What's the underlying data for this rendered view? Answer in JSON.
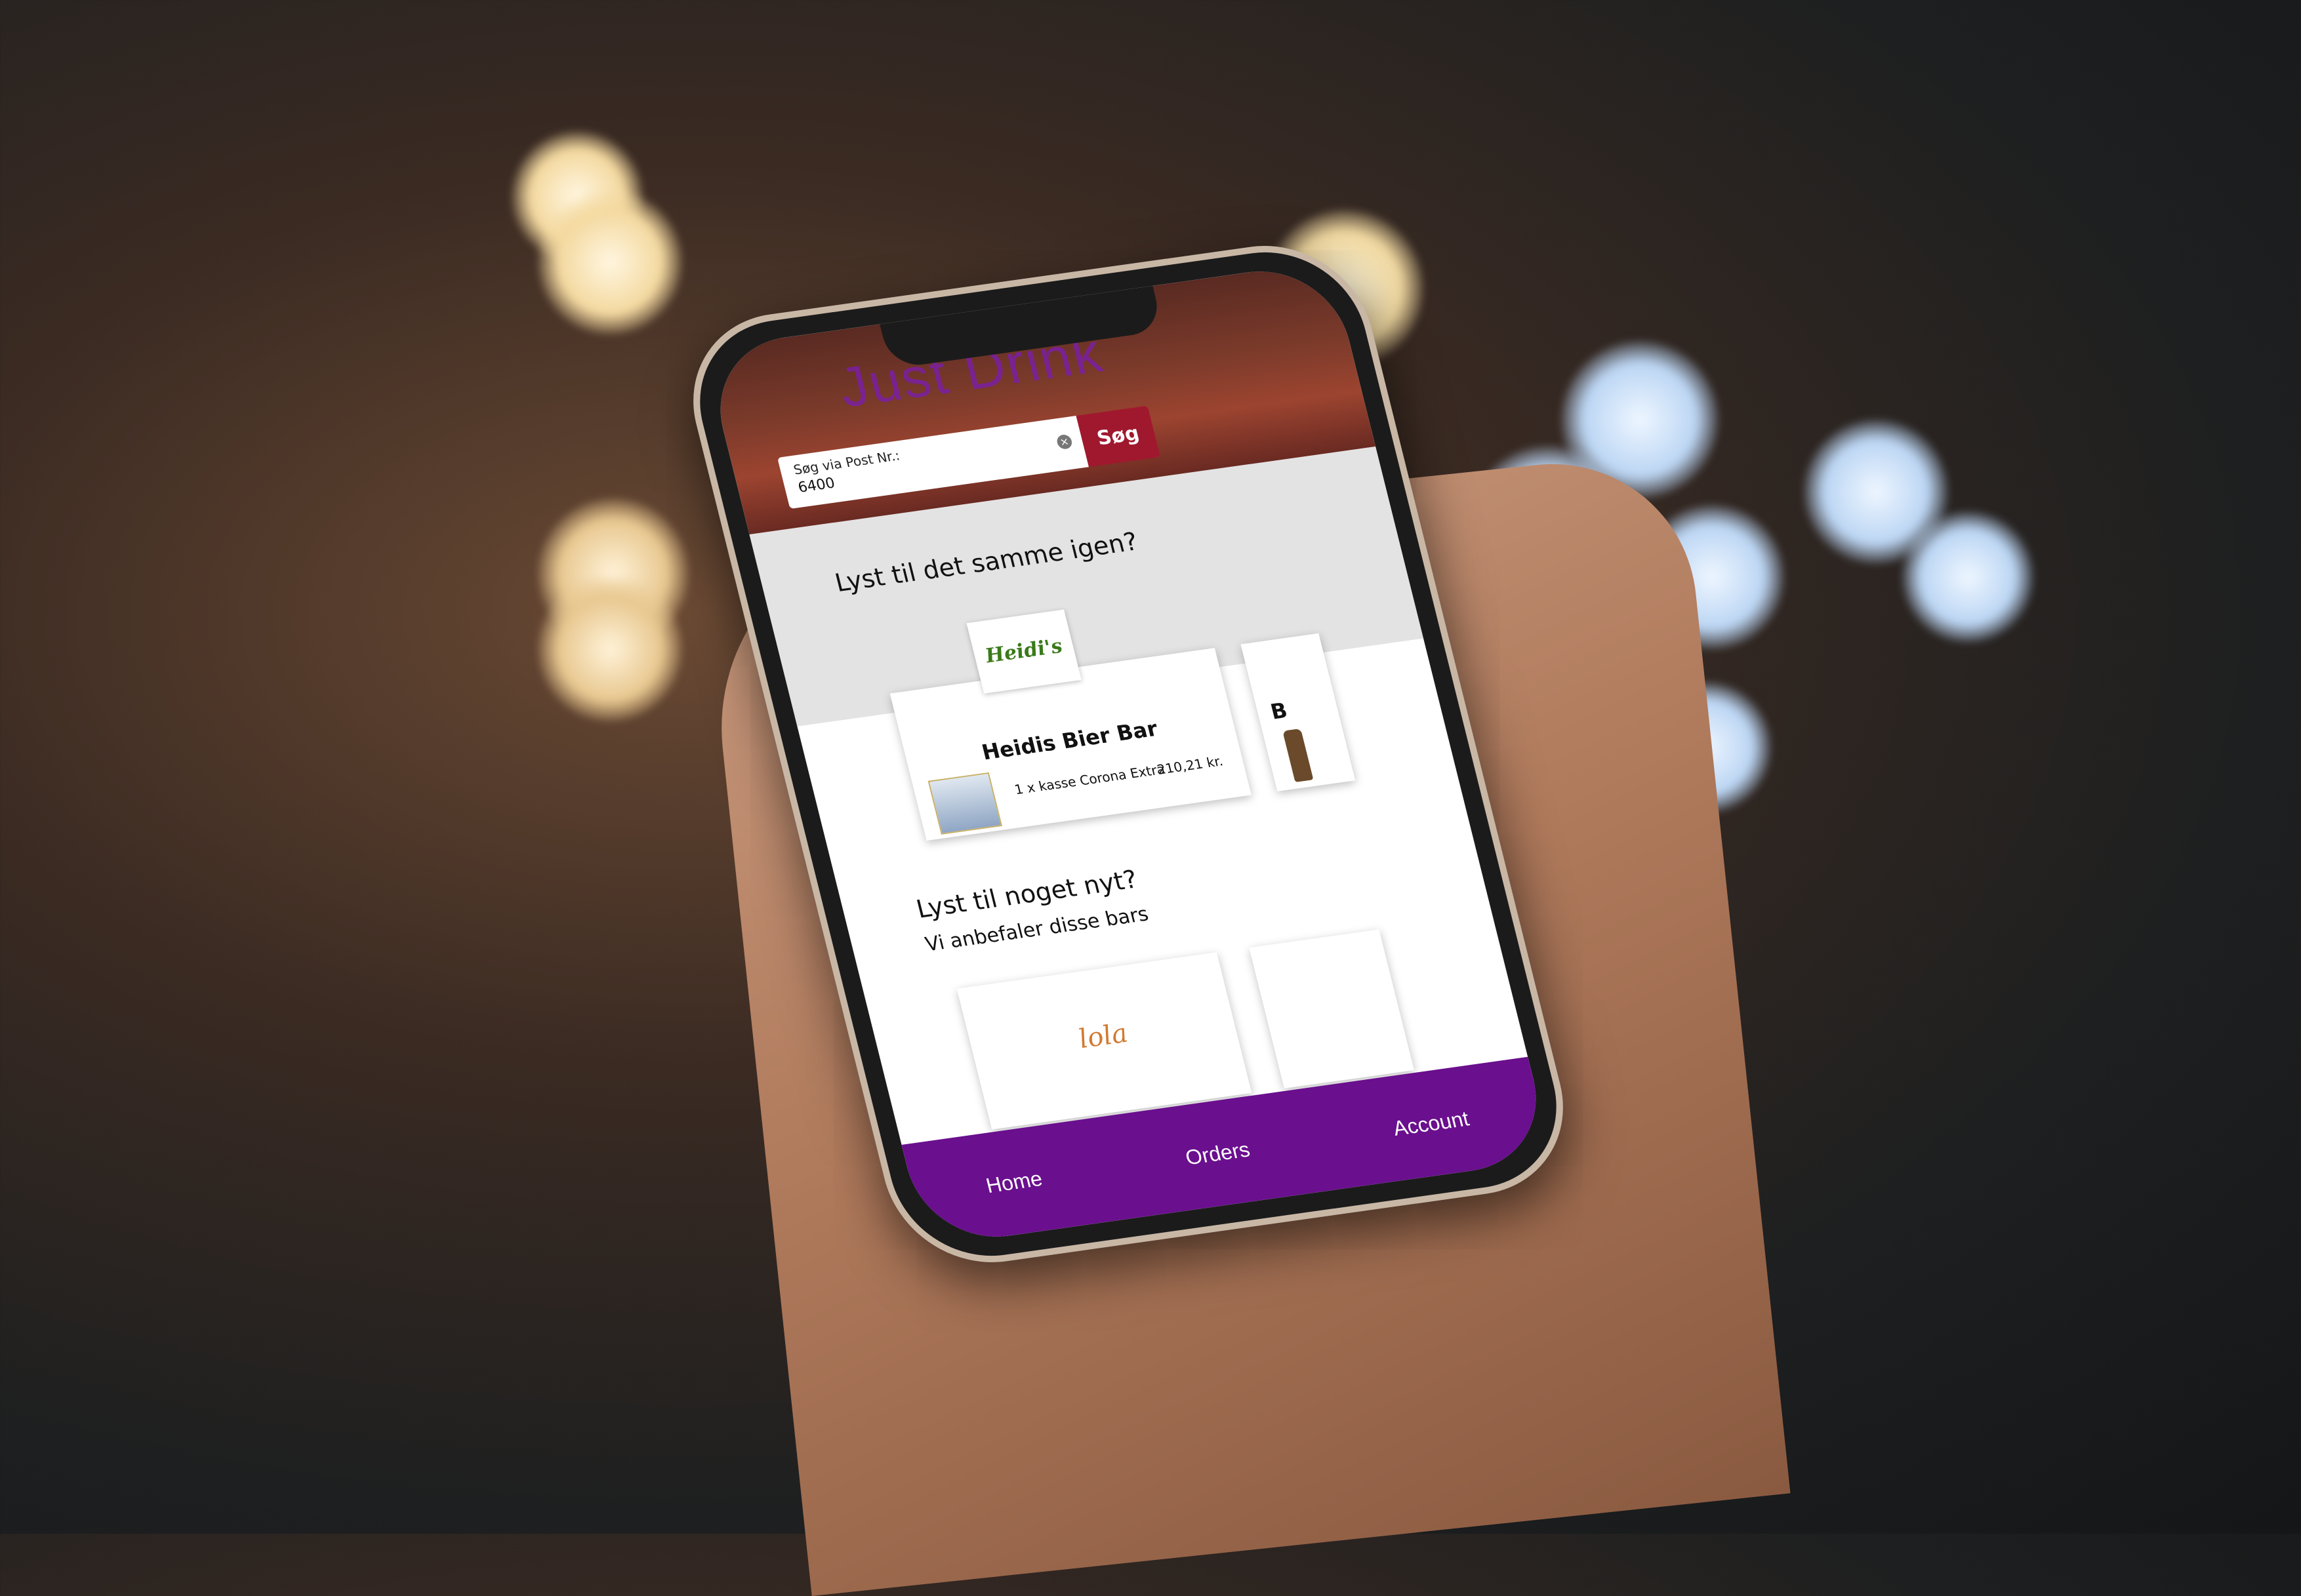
{
  "app": {
    "title": "Just Drink"
  },
  "search": {
    "label": "Søg via Post Nr.:",
    "value": "6400",
    "button_label": "Søg"
  },
  "reorder_section": {
    "heading": "Lyst til det samme igen?",
    "cards": [
      {
        "logo_text": "Heidi's",
        "bar_name": "Heidis Bier Bar",
        "item": "1 x kasse Corona Extra",
        "price": "210,21 kr."
      },
      {
        "bar_name_partial": "B"
      }
    ]
  },
  "discover_section": {
    "heading": "Lyst til noget nyt?",
    "subheading": "Vi anbefaler disse bars",
    "cards": [
      {
        "logo_text": "lola"
      }
    ]
  },
  "bottom_nav": {
    "items": [
      "Home",
      "Orders",
      "Account"
    ]
  },
  "colors": {
    "brand_purple": "#6a0f8e",
    "title_purple": "#7b1fa2",
    "search_button_red": "#a0182e"
  }
}
